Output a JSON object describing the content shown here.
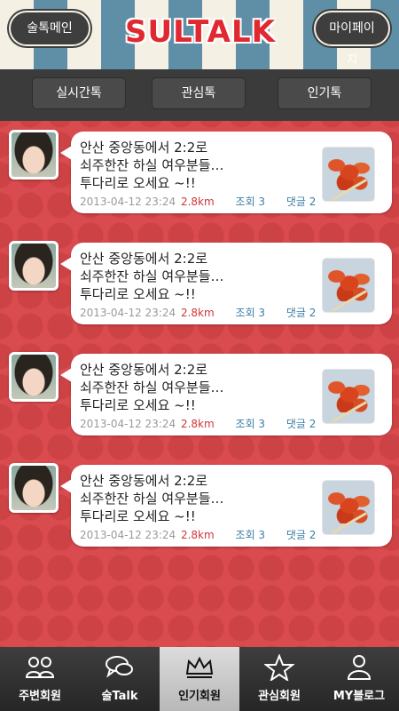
{
  "header": {
    "logo": "SULTALK",
    "left_button": "술톡메인",
    "right_button": "마이페이지"
  },
  "tabs": [
    {
      "label": "실시간톡"
    },
    {
      "label": "관심톡"
    },
    {
      "label": "인기톡"
    }
  ],
  "feed": [
    {
      "line1": "안산 중앙동에서 2:2로",
      "line2": "쇠주한잔 하실 여우분들…",
      "line3": "투다리로 오세요 ~!!",
      "date": "2013-04-12 23:24",
      "distance": "2.8km",
      "views": "조회 3",
      "replies": "댓글 2"
    },
    {
      "line1": "안산 중앙동에서 2:2로",
      "line2": "쇠주한잔 하실 여우분들…",
      "line3": "투다리로 오세요 ~!!",
      "date": "2013-04-12 23:24",
      "distance": "2.8km",
      "views": "조회 3",
      "replies": "댓글 2"
    },
    {
      "line1": "안산 중앙동에서 2:2로",
      "line2": "쇠주한잔 하실 여우분들…",
      "line3": "투다리로 오세요 ~!!",
      "date": "2013-04-12 23:24",
      "distance": "2.8km",
      "views": "조회 3",
      "replies": "댓글 2"
    },
    {
      "line1": "안산 중앙동에서 2:2로",
      "line2": "쇠주한잔 하실 여우분들…",
      "line3": "투다리로 오세요 ~!!",
      "date": "2013-04-12 23:24",
      "distance": "2.8km",
      "views": "조회 3",
      "replies": "댓글 2"
    }
  ],
  "bottom_nav": [
    {
      "label": "주변회원",
      "icon": "people-icon"
    },
    {
      "label": "술Talk",
      "icon": "chat-bubbles-icon"
    },
    {
      "label": "인기회원",
      "icon": "crown-icon",
      "active": true
    },
    {
      "label": "관심회원",
      "icon": "star-icon"
    },
    {
      "label": "MY블로그",
      "icon": "person-icon"
    }
  ],
  "colors": {
    "background": "#d94b4e",
    "awning_blue": "#5f8fa6",
    "awning_cream": "#f4f0e4",
    "logo_red": "#e02830",
    "distance_red": "#d03636",
    "meta_blue": "#3b7fa8"
  }
}
